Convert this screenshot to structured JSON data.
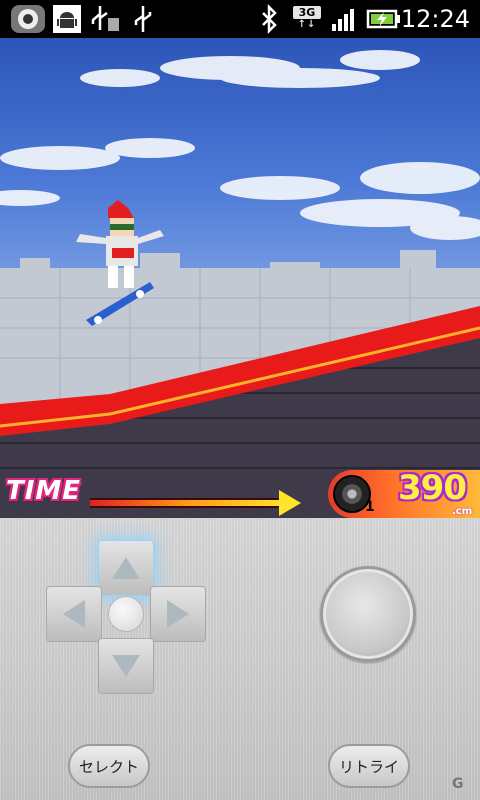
{
  "status_bar": {
    "time": "12:24",
    "network_type": "3G",
    "icons": [
      "camera-app-icon",
      "android-debug-icon",
      "usb-storage-icon",
      "usb-icon",
      "bluetooth-icon",
      "signal-icon",
      "battery-charging-icon"
    ]
  },
  "game": {
    "time_label": "TIME",
    "time_remaining_fraction": 0.75,
    "distance": "390",
    "distance_unit": ".cm",
    "lives": "1"
  },
  "controls": {
    "select_label": "セレクト",
    "retry_label": "リトライ",
    "watermark": "G"
  },
  "colors": {
    "sky": "#4c79d6",
    "rail": "#e81a1a",
    "time_label": "#e0267f",
    "distance_text": "#ffee44",
    "dpad_highlight": "#8cd2ff"
  }
}
